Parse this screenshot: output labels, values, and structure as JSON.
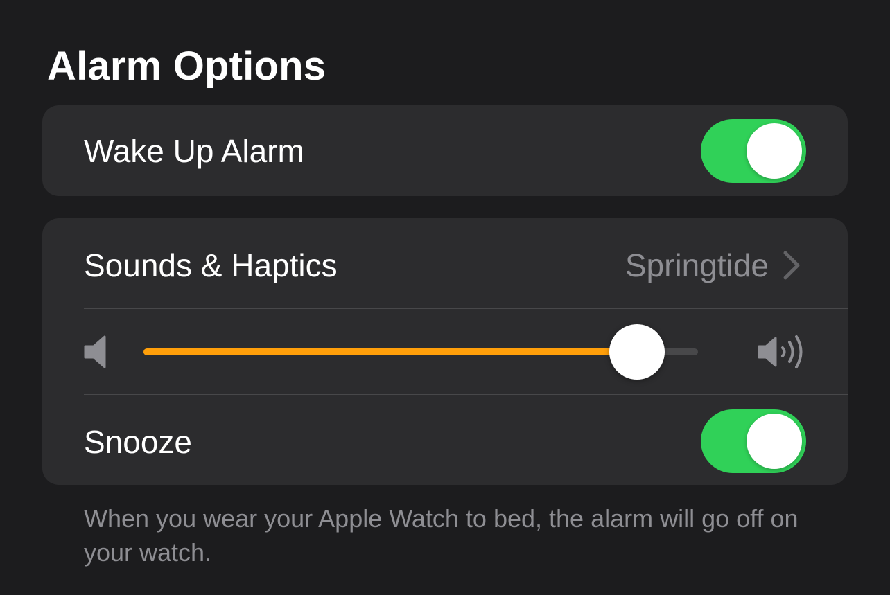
{
  "section": {
    "title": "Alarm Options"
  },
  "wake_up_alarm": {
    "label": "Wake Up Alarm",
    "enabled": true
  },
  "sounds_haptics": {
    "label": "Sounds & Haptics",
    "value": "Springtide"
  },
  "volume": {
    "level": 0.89
  },
  "snooze": {
    "label": "Snooze",
    "enabled": true
  },
  "footer": {
    "text": "When you wear your Apple Watch to bed, the alarm will go off on your watch."
  },
  "colors": {
    "background": "#1c1c1e",
    "group_background": "#2c2c2e",
    "toggle_on": "#30d158",
    "slider_fill": "#ff9f0a",
    "secondary_text": "#8e8e93"
  },
  "icons": {
    "volume_low": "speaker-low-icon",
    "volume_high": "speaker-high-icon",
    "disclosure": "chevron-right-icon"
  }
}
